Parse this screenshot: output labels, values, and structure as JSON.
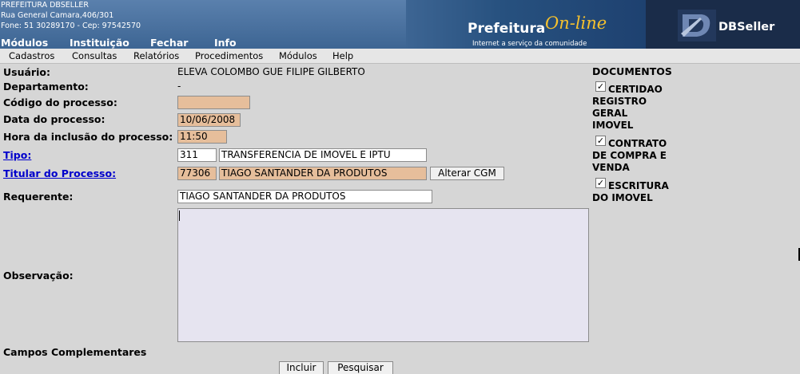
{
  "header": {
    "org_name": "PREFEITURA DBSELLER",
    "org_address": "Rua General Camara,406/301",
    "org_phone": "Fone: 51 30289170  -  Cep: 97542570",
    "top_menu": [
      "Módulos",
      "Instituição",
      "Fechar",
      "Info"
    ],
    "prefeitura_logo_main": "Prefeitura",
    "prefeitura_logo_online": "On-line",
    "prefeitura_logo_tagline": "Internet a serviço da comunidade",
    "dbseller_logo_text": "DBSeller"
  },
  "menubar": [
    "Cadastros",
    "Consultas",
    "Relatórios",
    "Procedimentos",
    "Módulos",
    "Help"
  ],
  "form": {
    "usuario_label": "Usuário:",
    "usuario_value": "ELEVA COLOMBO GUE FILIPE GILBERTO",
    "departamento_label": "Departamento:",
    "departamento_value": "-",
    "codigo_label": "Código do processo:",
    "codigo_value": "",
    "data_label": "Data do processo:",
    "data_value": "10/06/2008",
    "hora_label": "Hora da inclusão do processo:",
    "hora_value": "11:50",
    "tipo_label": "Tipo:",
    "tipo_code": "311",
    "tipo_desc": "TRANSFERENCIA DE IMOVEL E IPTU",
    "titular_label": "Titular do Processo:",
    "titular_code": "77306",
    "titular_name": "TIAGO SANTANDER DA PRODUTOS",
    "alterar_cgm_button": "Alterar CGM",
    "requerente_label": "Requerente:",
    "requerente_value": "TIAGO SANTANDER DA PRODUTOS",
    "observacao_label": "Observação:",
    "observacao_value": "",
    "campos_label": "Campos Complementares",
    "incluir_button": "Incluir",
    "pesquisar_button": "Pesquisar"
  },
  "documents": {
    "title": "DOCUMENTOS",
    "items": [
      {
        "label": "CERTIDAO REGISTRO GERAL IMOVEL",
        "checked": true,
        "mark": "✓"
      },
      {
        "label": "CONTRATO DE COMPRA E VENDA",
        "checked": true,
        "mark": "✓"
      },
      {
        "label": "ESCRITURA DO IMOVEL",
        "checked": true,
        "mark": "✓"
      }
    ]
  },
  "colors": {
    "header_blue": "#4a6f9c",
    "header_dark": "#1a2c49",
    "logo_yellow": "#f6c12d",
    "page_background": "#d6d6d6",
    "readonly_field": "#e6be9b",
    "textarea_background": "#e6e4f0",
    "link_blue": "#0000cc"
  }
}
